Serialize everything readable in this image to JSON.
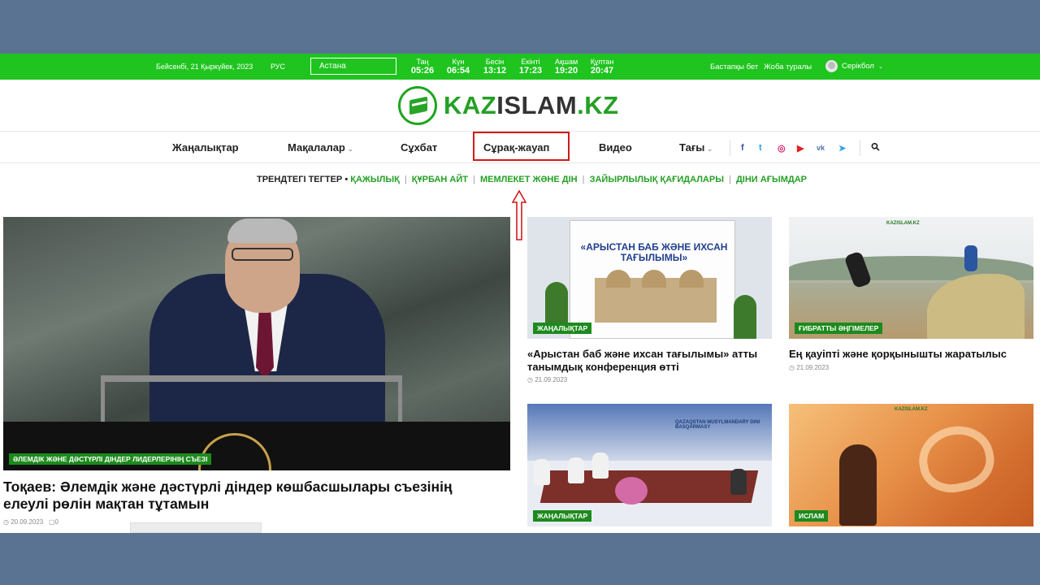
{
  "topbar": {
    "date": "Бейсенбі, 21 Қыркүйек, 2023",
    "lang": "РУС",
    "city": "Астана",
    "prayers": [
      {
        "name": "Таң",
        "time": "05:26"
      },
      {
        "name": "Күн",
        "time": "06:54"
      },
      {
        "name": "Бесін",
        "time": "13:12"
      },
      {
        "name": "Екінті",
        "time": "17:23"
      },
      {
        "name": "Ақшам",
        "time": "19:20"
      },
      {
        "name": "Құптан",
        "time": "20:47"
      }
    ],
    "links": [
      "Бастапқы бет",
      "Жоба туралы"
    ],
    "user": "Серікбол"
  },
  "logo": {
    "green": "KAZ",
    "dark": "ISLAM",
    "green2": ".KZ"
  },
  "nav": {
    "items": [
      "Жаңалықтар",
      "Мақалалар",
      "Сұхбат",
      "Сұрақ-жауап",
      "Видео",
      "Тағы"
    ],
    "social": [
      "facebook-icon",
      "twitter-icon",
      "instagram-icon",
      "youtube-icon",
      "vk-icon",
      "telegram-icon"
    ],
    "social_glyphs": [
      "f",
      "t",
      "◎",
      "▶",
      "vk",
      "➤"
    ],
    "search_glyph": "⚲"
  },
  "trends": {
    "label": "ТРЕНДТЕГІ ТЕГТЕР •",
    "tags": [
      "ҚАЖЫЛЫҚ",
      "ҚҰРБАН АЙТ",
      "МЕМЛЕКЕТ ЖӘНЕ ДІН",
      "ЗАЙЫРЛЫЛЫҚ ҚАҒИДАЛАРЫ",
      "ДІНИ АҒЫМДАР"
    ],
    "sep": "|"
  },
  "featured": {
    "category": "ӘЛЕМДІК ЖӘНЕ ДӘСТҮРЛІ ДІНДЕР ЛИДЕРЛЕРІНІҢ СЪЕЗІ",
    "title": "Тоқаев: Әлемдік және дәстүрлі діндер көшбасшылары съезінің елеулі рөлін мақтан тұтамын",
    "date": "◷ 20.09.2023",
    "comments": "▢0"
  },
  "cards": [
    {
      "category": "ЖАҢАЛЫҚТАР",
      "title": "«Арыстан баб және ихсан тағылымы» атты танымдық конференция өтті",
      "date": "◷ 21.09.2023",
      "image_text": "«АРЫСТАН БАБ ЖӘНЕ ИХСАН ТАҒЫЛЫМЫ»"
    },
    {
      "category": "ҒИБРАТТЫ ӘҢГІМЕЛЕР",
      "title": "Ең қауіпті және қорқынышты жаратылыс",
      "date": "◷ 21.09.2023",
      "image_text": "KAZISLAM.KZ"
    },
    {
      "category": "ЖАҢАЛЫҚТАР",
      "image_text": "QAZAQSTAN MUSYLMANDARY DINI BASQARMASY"
    },
    {
      "category": "ИСЛАМ",
      "image_text": "KAZISLAM.KZ"
    }
  ],
  "colors": {
    "brand": "#1fc41f",
    "badge": "#1d8a1d",
    "annotation": "#d11a1a",
    "backdrop": "#5a7393"
  }
}
